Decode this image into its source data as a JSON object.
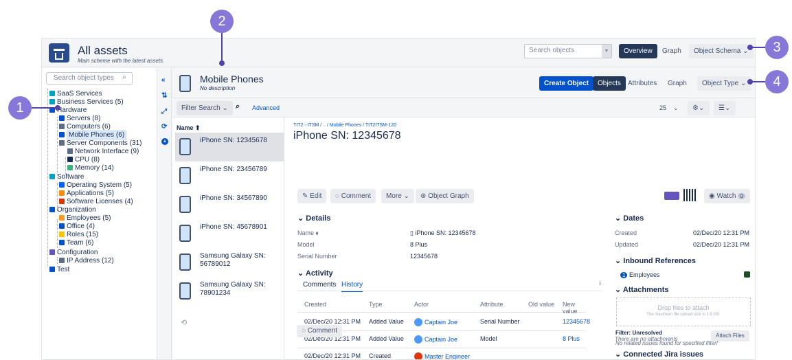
{
  "callouts": [
    "1",
    "2",
    "3",
    "4"
  ],
  "header": {
    "title": "All assets",
    "subtitle": "Main scheme with the latest assets.",
    "search_placeholder": "Search objects",
    "overview_label": "Overview",
    "graph_label": "Graph",
    "schema_label": "Object Schema ⌄"
  },
  "tree": {
    "search_placeholder": "Search object types",
    "items": [
      {
        "label": "SaaS Services",
        "color": "#00a3bf"
      },
      {
        "label": "Business Services (5)",
        "color": "#00a3bf"
      },
      {
        "label": "Hardware",
        "color": "#0052cc"
      },
      {
        "label": "Servers (8)",
        "color": "#0052cc"
      },
      {
        "label": "Computers (6)",
        "color": "#5e6c84"
      },
      {
        "label": "Mobile Phones (6)",
        "color": "#0052cc"
      },
      {
        "label": "Server Components (31)",
        "color": "#5e6c84"
      },
      {
        "label": "Network Interface (9)",
        "color": "#5e6c84"
      },
      {
        "label": "CPU (8)",
        "color": "#172b4d"
      },
      {
        "label": "Memory (14)",
        "color": "#36b37e"
      },
      {
        "label": "Software",
        "color": "#00a3bf"
      },
      {
        "label": "Operating System (5)",
        "color": "#0065ff"
      },
      {
        "label": "Applications (5)",
        "color": "#ff8b00"
      },
      {
        "label": "Software Licenses (4)",
        "color": "#de350b"
      },
      {
        "label": "Organization",
        "color": "#0052cc"
      },
      {
        "label": "Employees (5)",
        "color": "#ff991f"
      },
      {
        "label": "Office (4)",
        "color": "#0052cc"
      },
      {
        "label": "Roles (15)",
        "color": "#ffc400"
      },
      {
        "label": "Team (6)",
        "color": "#0052cc"
      },
      {
        "label": "Configuration",
        "color": "#6554c0"
      },
      {
        "label": "IP Address (12)",
        "color": "#5e6c84"
      },
      {
        "label": "Test",
        "color": "#0052cc"
      }
    ]
  },
  "main": {
    "title": "Mobile Phones",
    "description": "No description",
    "create_label": "Create Object",
    "tabs": [
      "Objects",
      "Attributes",
      "Graph",
      "Object Type ⌄"
    ],
    "filter_label": "Filter Search ⌄",
    "advanced_label": "Advanced",
    "page_size": "25"
  },
  "list": {
    "header": "Name ⬆",
    "items": [
      "iPhone SN: 12345678",
      "iPhone SN: 23456789",
      "iPhone SN: 34567890",
      "iPhone SN: 45678901",
      "Samsung Galaxy SN: 56789012",
      "Samsung Galaxy SN: 78901234"
    ]
  },
  "detail": {
    "breadcrumb": "TIT2 - ITSM / .. / Mobile Phones / TIT2ITSM-120",
    "title": "iPhone SN: 12345678",
    "edit": "Edit",
    "comment": "Comment",
    "more": "More ⌄",
    "object_graph": "Object Graph",
    "watch": "Watch",
    "watch_count": "0",
    "details_heading": "Details",
    "fields": [
      {
        "key": "Name",
        "value": "iPhone SN: 12345678"
      },
      {
        "key": "Model",
        "value": "8 Plus"
      },
      {
        "key": "Serial Number",
        "value": "12345678"
      }
    ],
    "activity_heading": "Activity",
    "activity_tabs": [
      "Comments",
      "History"
    ],
    "history_cols": [
      "Created",
      "Type",
      "Actor",
      "Attribute",
      "Old value",
      "New value"
    ],
    "history": [
      {
        "created": "02/Dec/20 12:31 PM",
        "type": "Added Value",
        "actor": "Captain Joe",
        "attribute": "Serial Number",
        "old": "",
        "new": "12345678"
      },
      {
        "created": "02/Dec/20 12:31 PM",
        "type": "Added Value",
        "actor": "Captain Joe",
        "attribute": "Model",
        "old": "",
        "new": "8 Plus"
      },
      {
        "created": "02/Dec/20 12:31 PM",
        "type": "Created",
        "actor": "Master Engineer",
        "attribute": "",
        "old": "",
        "new": ""
      }
    ],
    "comment_button": "Comment"
  },
  "side": {
    "dates_heading": "Dates",
    "created_label": "Created",
    "created_value": "02/Dec/20 12:31 PM",
    "updated_label": "Updated",
    "updated_value": "02/Dec/20 12:31 PM",
    "inbound_heading": "Inbound References",
    "inbound_count": "1",
    "inbound_label": "Employees",
    "attachments_heading": "Attachments",
    "drop_text": "Drop files to attach",
    "drop_sub": "The maximum file upload size is 1.9 GB.",
    "no_attach": "There are no attachments",
    "attach_btn": "Attach Files",
    "jira_heading": "Connected Jira issues",
    "filter_text": "Filter: Unresolved",
    "no_issues": "No related issues found for specified filter!"
  }
}
